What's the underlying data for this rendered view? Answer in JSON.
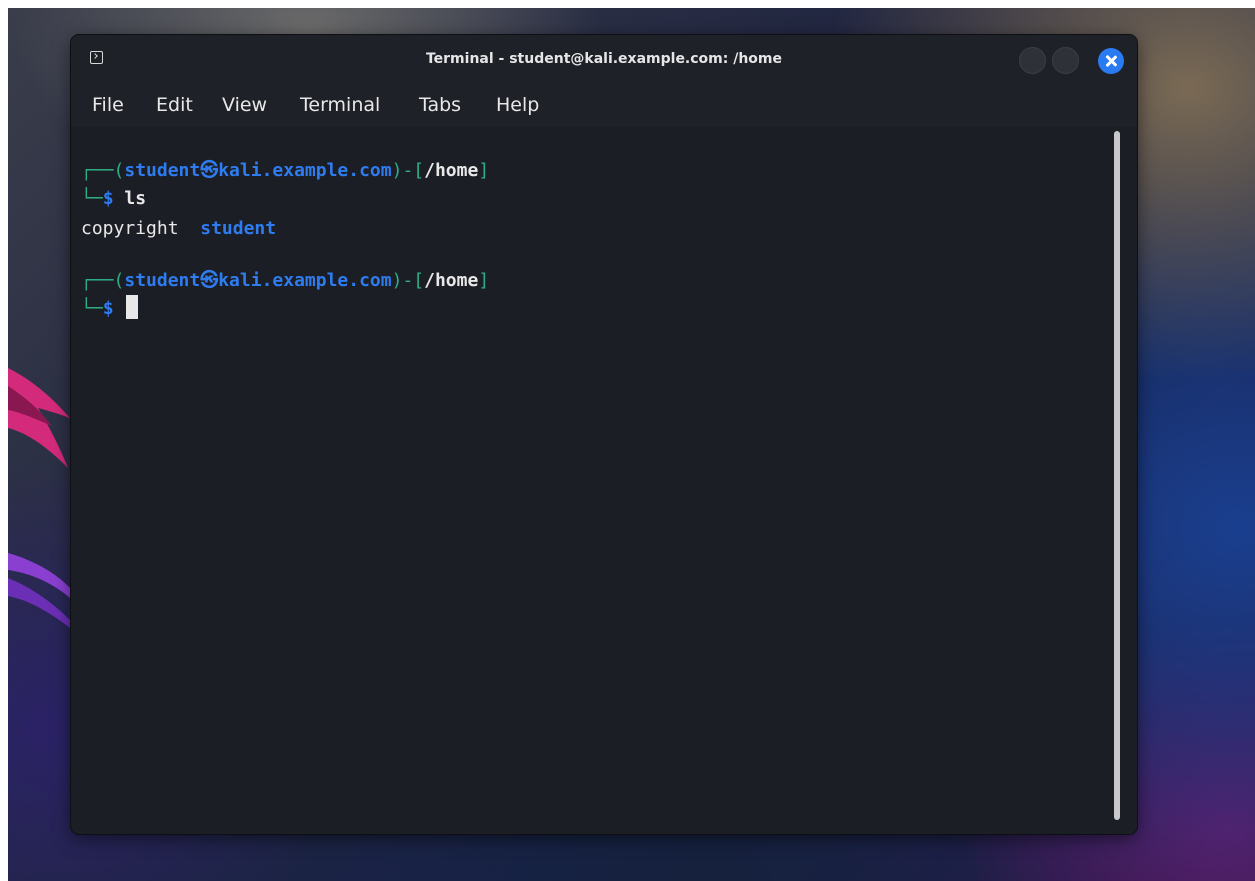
{
  "window": {
    "title": "Terminal - student@kali.example.com: /home"
  },
  "menu": [
    "File",
    "Edit",
    "View",
    "Terminal",
    "Tabs",
    "Help"
  ],
  "terminal": {
    "prompt1": {
      "corner": "┌──(",
      "user": "student",
      "at": "㉿",
      "host": "kali.example.com",
      "sep": ")-[",
      "path": "/home",
      "end": "]"
    },
    "cmd1": {
      "corner": "└─",
      "dollar": "$",
      "command": "ls"
    },
    "output": {
      "file1": "copyright",
      "dir1": "student"
    },
    "prompt2": {
      "corner": "┌──(",
      "user": "student",
      "at": "㉿",
      "host": "kali.example.com",
      "sep": ")-[",
      "path": "/home",
      "end": "]"
    },
    "cmd2": {
      "corner": "└─",
      "dollar": "$"
    }
  },
  "colors": {
    "prompt_frame": "#2fae85",
    "prompt_user_host": "#2e7cf0",
    "directory": "#2e7cf0",
    "close_button": "#2a7bf2",
    "terminal_background": "#1c1e25"
  },
  "icons": [
    "terminal-app-icon",
    "minimize-icon",
    "maximize-icon",
    "close-icon"
  ]
}
